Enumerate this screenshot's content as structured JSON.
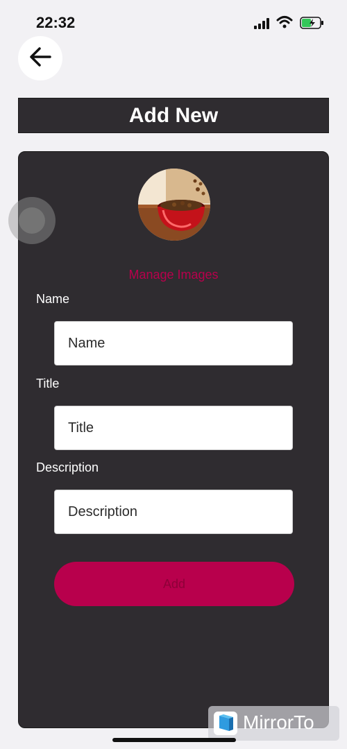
{
  "status_bar": {
    "time": "22:32"
  },
  "header": {
    "title": "Add New"
  },
  "image_picker": {
    "manage_label": "Manage Images"
  },
  "form": {
    "name_label": "Name",
    "name_placeholder": "Name",
    "title_label": "Title",
    "title_placeholder": "Title",
    "description_label": "Description",
    "description_placeholder": "Description",
    "submit_label": "Add"
  },
  "watermark": {
    "text": "MirrorTo"
  },
  "colors": {
    "accent": "#b8004c",
    "panel": "#2f2c30",
    "background": "#f2f1f4"
  }
}
